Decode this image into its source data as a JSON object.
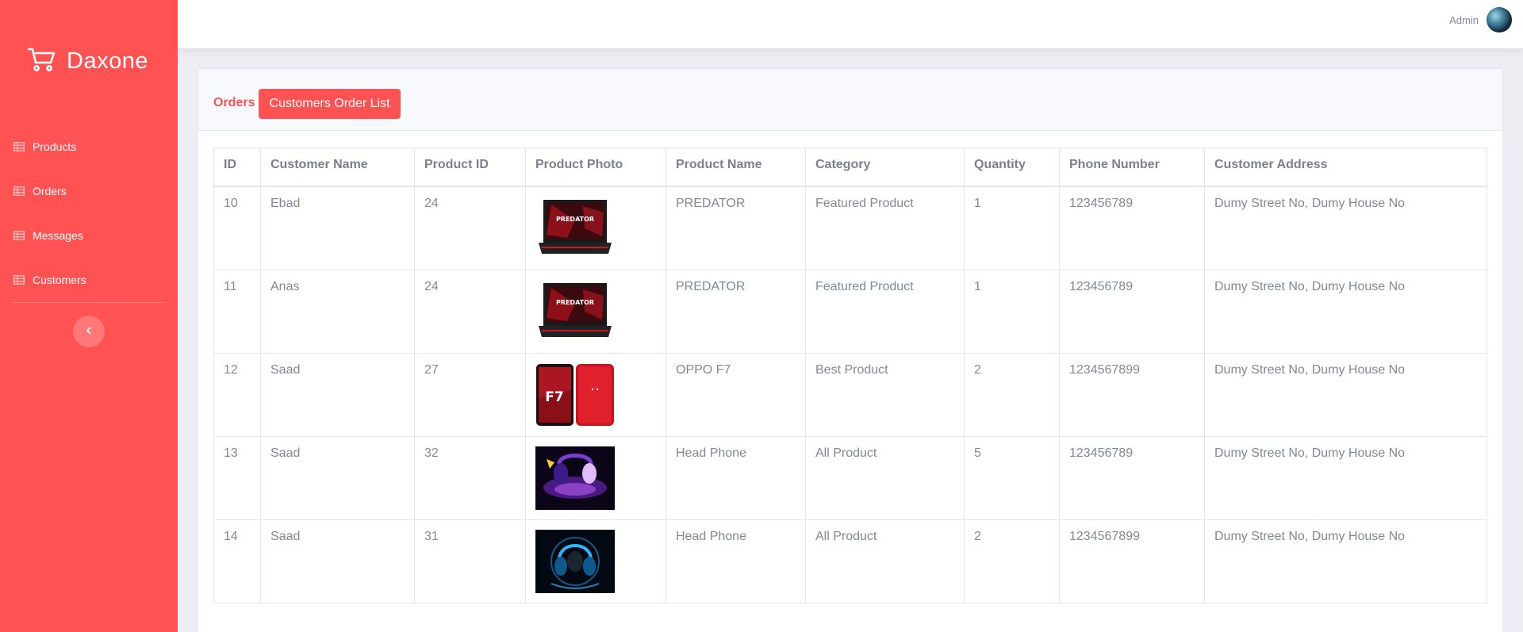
{
  "brand": {
    "name": "Daxone",
    "logo_icon": "cart-icon"
  },
  "sidebar": {
    "items": [
      {
        "label": "Products",
        "icon": "table-icon"
      },
      {
        "label": "Orders",
        "icon": "table-icon"
      },
      {
        "label": "Messages",
        "icon": "table-icon"
      },
      {
        "label": "Customers",
        "icon": "table-icon"
      }
    ],
    "toggle_icon": "chevron-left-icon"
  },
  "topbar": {
    "user_name": "Admin"
  },
  "page": {
    "title": "Orders",
    "button": "Customers Order List"
  },
  "table": {
    "headers": [
      "ID",
      "Customer Name",
      "Product ID",
      "Product Photo",
      "Product Name",
      "Category",
      "Quantity",
      "Phone Number",
      "Customer Address"
    ],
    "rows": [
      {
        "id": "10",
        "customer": "Ebad",
        "product_id": "24",
        "photo": "laptop",
        "photo_text": "PREDATOR",
        "product_name": "PREDATOR",
        "category": "Featured Product",
        "quantity": "1",
        "phone": "123456789",
        "address": "Dumy Street No, Dumy House No"
      },
      {
        "id": "11",
        "customer": "Anas",
        "product_id": "24",
        "photo": "laptop",
        "photo_text": "PREDATOR",
        "product_name": "PREDATOR",
        "category": "Featured Product",
        "quantity": "1",
        "phone": "123456789",
        "address": "Dumy Street No, Dumy House No"
      },
      {
        "id": "12",
        "customer": "Saad",
        "product_id": "27",
        "photo": "phone",
        "photo_text": "F7",
        "product_name": "OPPO F7",
        "category": "Best Product",
        "quantity": "2",
        "phone": "1234567899",
        "address": "Dumy Street No, Dumy House No"
      },
      {
        "id": "13",
        "customer": "Saad",
        "product_id": "32",
        "photo": "headphone-purple",
        "product_name": "Head Phone",
        "category": "All Product",
        "quantity": "5",
        "phone": "123456789",
        "address": "Dumy Street No, Dumy House No"
      },
      {
        "id": "14",
        "customer": "Saad",
        "product_id": "31",
        "photo": "headphone-blue",
        "product_name": "Head Phone",
        "category": "All Product",
        "quantity": "2",
        "phone": "1234567899",
        "address": "Dumy Street No, Dumy House No"
      }
    ]
  },
  "colors": {
    "accent": "#ff5252",
    "text": "#858796",
    "border": "#e3e6f0"
  }
}
